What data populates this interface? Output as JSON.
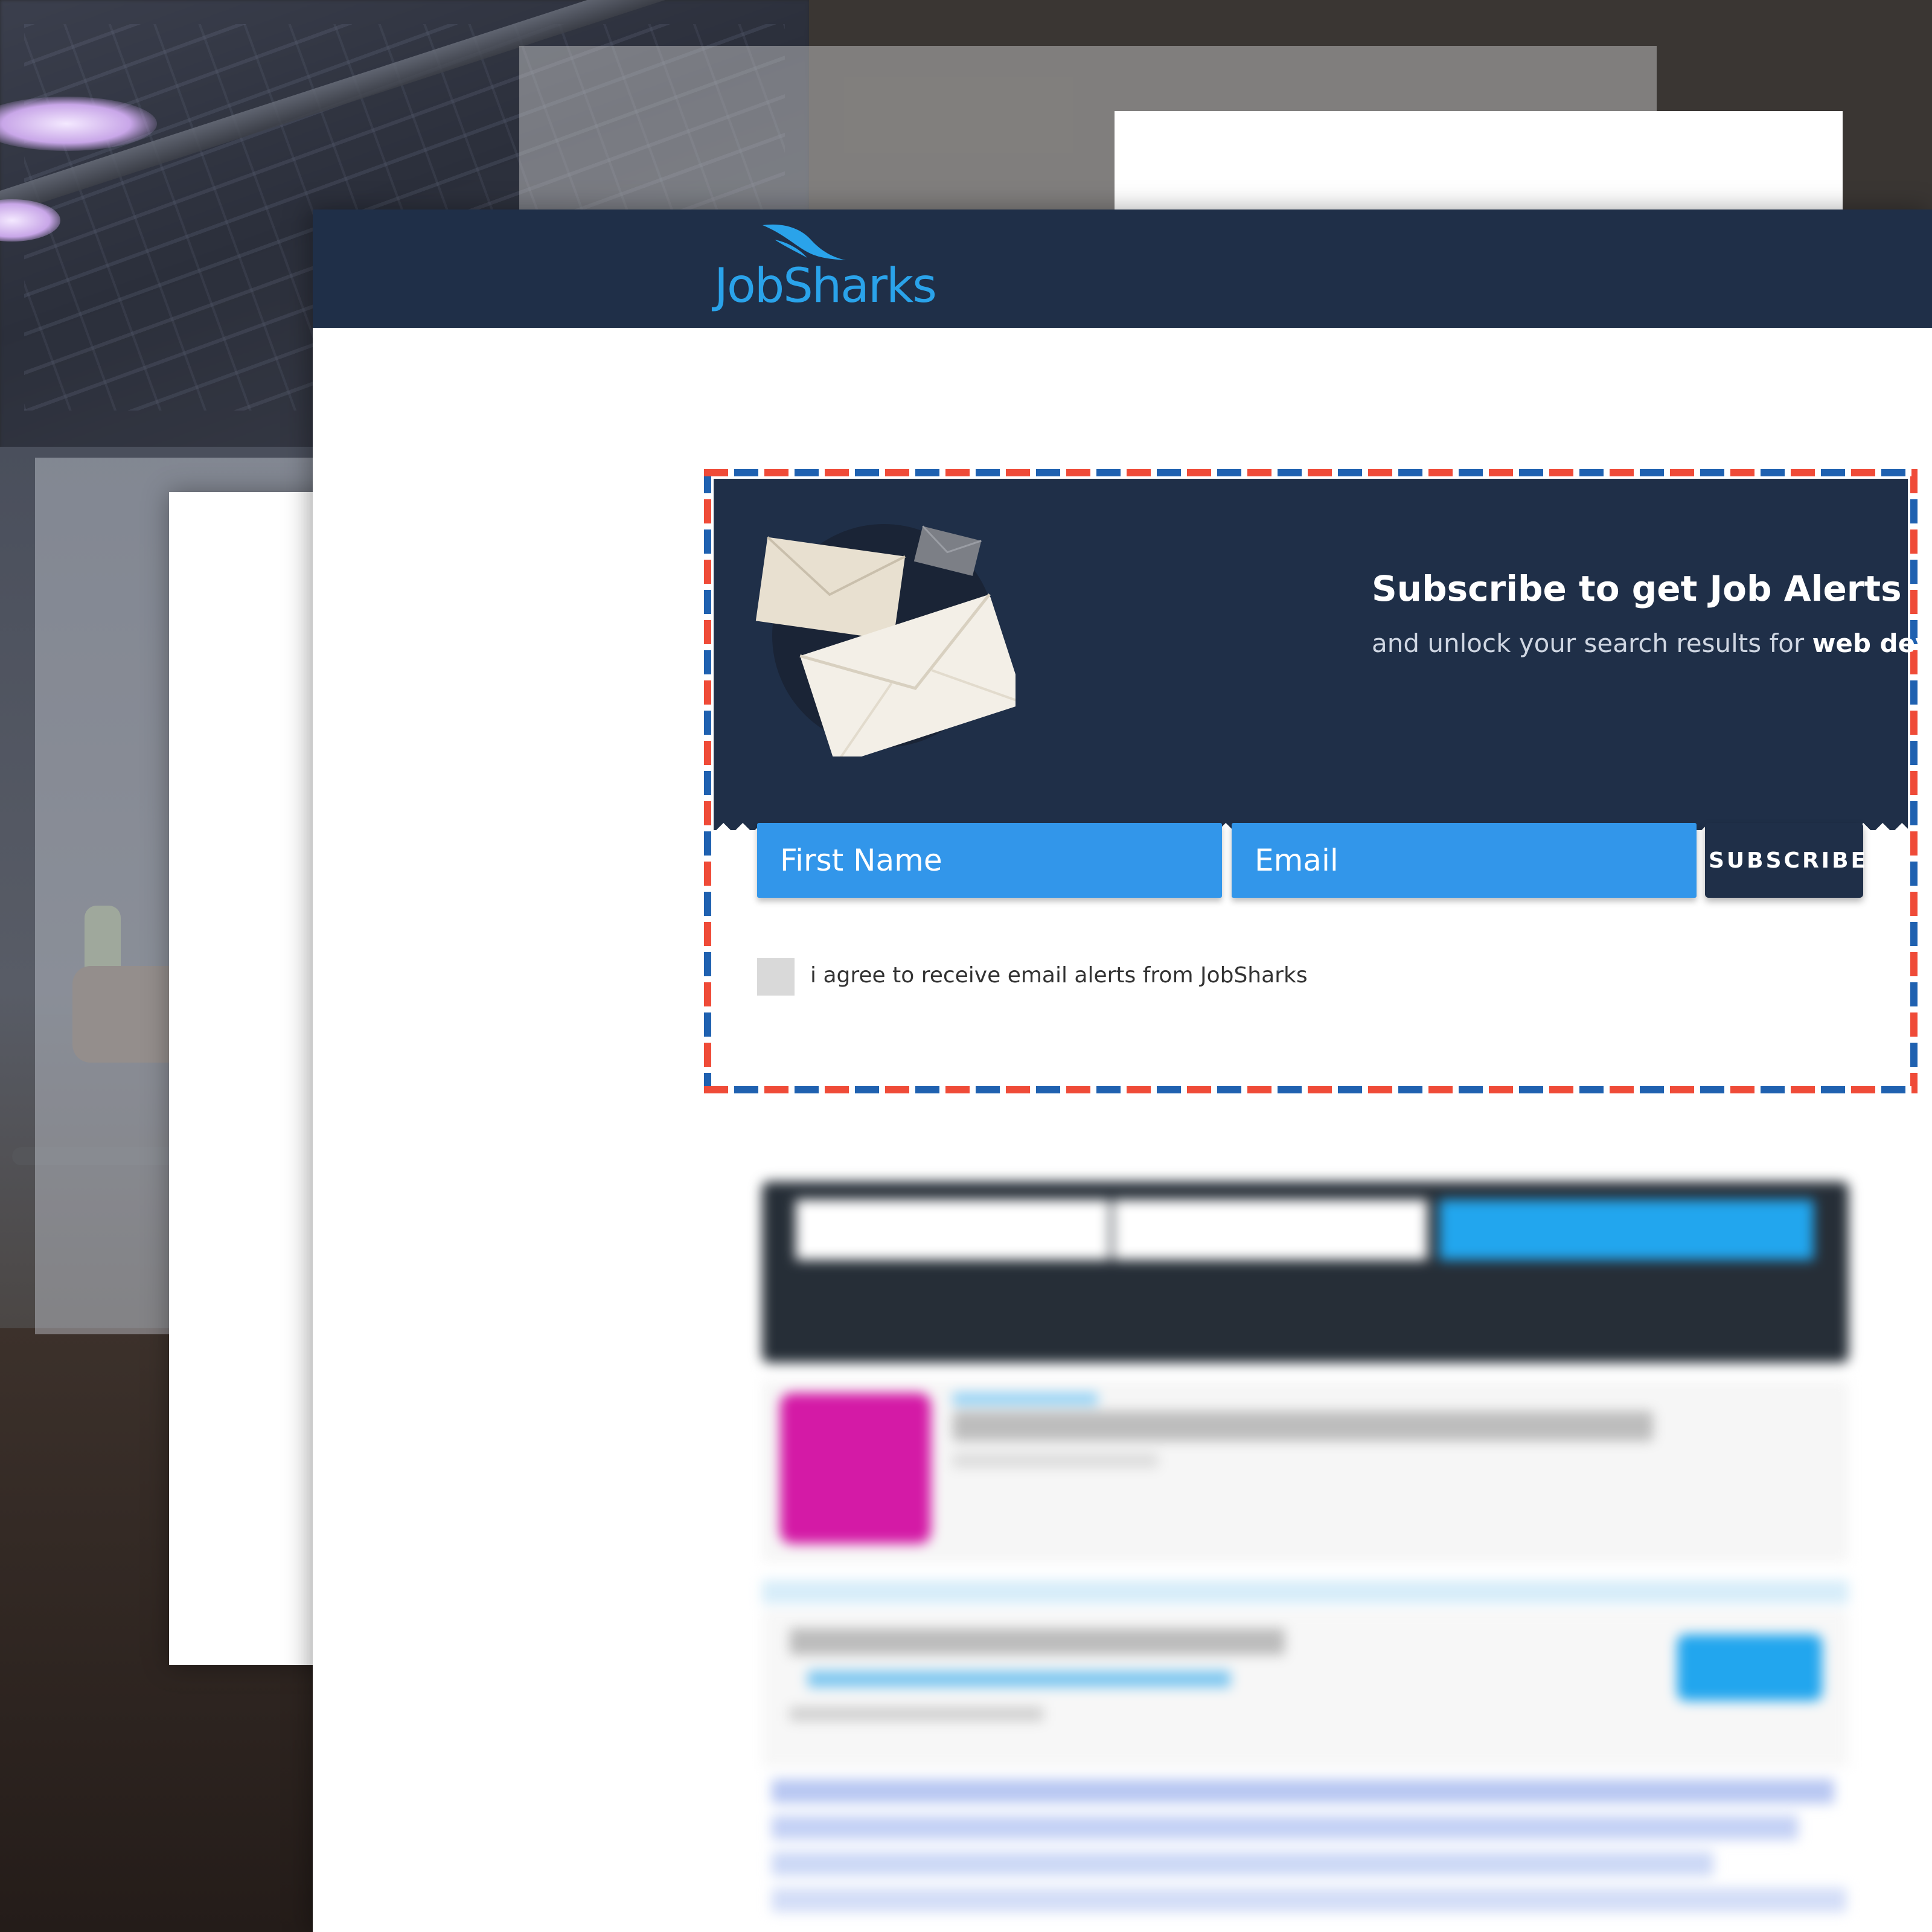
{
  "header": {
    "brand_name": "JobSharks"
  },
  "subscribe": {
    "title": "Subscribe to get Job Alerts",
    "subtitle_prefix": "and unlock your search results for",
    "subtitle_query": "web developer",
    "first_name_placeholder": "First Name",
    "email_placeholder": "Email",
    "button_label": "SUBSCRIBE",
    "agree_label": "i agree to receive email alerts from JobSharks",
    "agree_checked": false
  },
  "colors": {
    "header_navy": "#1f2f48",
    "field_blue": "#3296ea",
    "brand_blue": "#2aa3ea",
    "airmail_red": "#ef4b38",
    "airmail_blue": "#1f61b0"
  },
  "icons": [
    "shark-fin-icon",
    "envelopes-icon"
  ]
}
